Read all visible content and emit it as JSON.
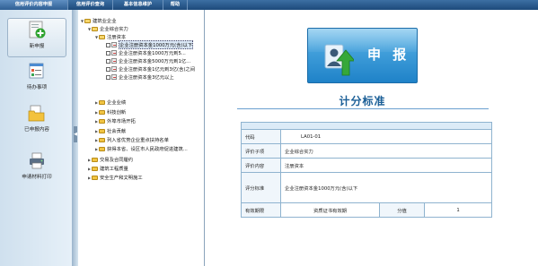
{
  "topnav": {
    "tabs": [
      {
        "label": "信用评价内容申报",
        "active": true
      },
      {
        "label": "信用评价查询",
        "active": false
      },
      {
        "label": "基本信息维护",
        "active": false
      },
      {
        "label": "帮助",
        "active": false
      }
    ]
  },
  "sidebar": {
    "items": [
      {
        "label": "新申报",
        "icon": "add-document-icon",
        "active": true
      },
      {
        "label": "待办事项",
        "icon": "task-list-icon",
        "active": false
      },
      {
        "label": "已申报内容",
        "icon": "folder-document-icon",
        "active": false
      },
      {
        "label": "申请材料打印",
        "icon": "printer-icon",
        "active": false
      }
    ]
  },
  "tree": {
    "nodes": [
      {
        "label": "建筑业企业",
        "level": 0,
        "toggle": "▼",
        "type": "folder-open"
      },
      {
        "label": "企业综合实力",
        "level": 1,
        "toggle": "▼",
        "type": "folder-open"
      },
      {
        "label": "注册资本",
        "level": 2,
        "toggle": "▼",
        "type": "folder-open"
      },
      {
        "label": "企业注册资本金1000万元(含)以下",
        "level": 3,
        "toggle": "",
        "type": "doc",
        "selected": true
      },
      {
        "label": "企业注册资本金1000万元到5...",
        "level": 3,
        "toggle": "",
        "type": "doc"
      },
      {
        "label": "企业注册资本金5000万元到1亿...",
        "level": 3,
        "toggle": "",
        "type": "doc"
      },
      {
        "label": "企业注册资本金1亿元到3亿(含)之间",
        "level": 3,
        "toggle": "",
        "type": "doc"
      },
      {
        "label": "企业注册资本金3亿元以上",
        "level": 3,
        "toggle": "",
        "type": "doc"
      },
      {
        "label": "企业业绩",
        "level": 2,
        "toggle": "▶",
        "type": "folder"
      },
      {
        "label": "科技创新",
        "level": 2,
        "toggle": "▶",
        "type": "folder"
      },
      {
        "label": "外埠市场开拓",
        "level": 2,
        "toggle": "▶",
        "type": "folder"
      },
      {
        "label": "社会贡献",
        "level": 2,
        "toggle": "▶",
        "type": "folder"
      },
      {
        "label": "列入省优势企业重点扶持名单",
        "level": 2,
        "toggle": "▶",
        "type": "folder"
      },
      {
        "label": "获得本省、设区市人民政府促进建筑...",
        "level": 2,
        "toggle": "▶",
        "type": "folder"
      },
      {
        "label": "交易及合同履约",
        "level": 1,
        "toggle": "▶",
        "type": "folder"
      },
      {
        "label": "建筑工程质量",
        "level": 1,
        "toggle": "▶",
        "type": "folder"
      },
      {
        "label": "安全生产和文明施工",
        "level": 1,
        "toggle": "▶",
        "type": "folder"
      }
    ]
  },
  "main": {
    "banner_text": "申 报",
    "title": "计分标准",
    "table": {
      "code_label": "代码",
      "code_value": "LA01-01",
      "item_label": "评价子项",
      "item_value": "企业综合实力",
      "content_label": "评价内容",
      "content_value": "注册资本",
      "standard_label": "评分标准",
      "standard_value": "企业注册资本金1000万元(含)以下",
      "valid_label": "有效期限",
      "valid_value": "资质证书有效期",
      "score_label": "分值",
      "score_value": "1"
    }
  },
  "colors": {
    "nav_bg": "#1d4a7b",
    "title": "#1b5f97",
    "banner": "#1f82c8",
    "arrow_green": "#36a83a"
  }
}
